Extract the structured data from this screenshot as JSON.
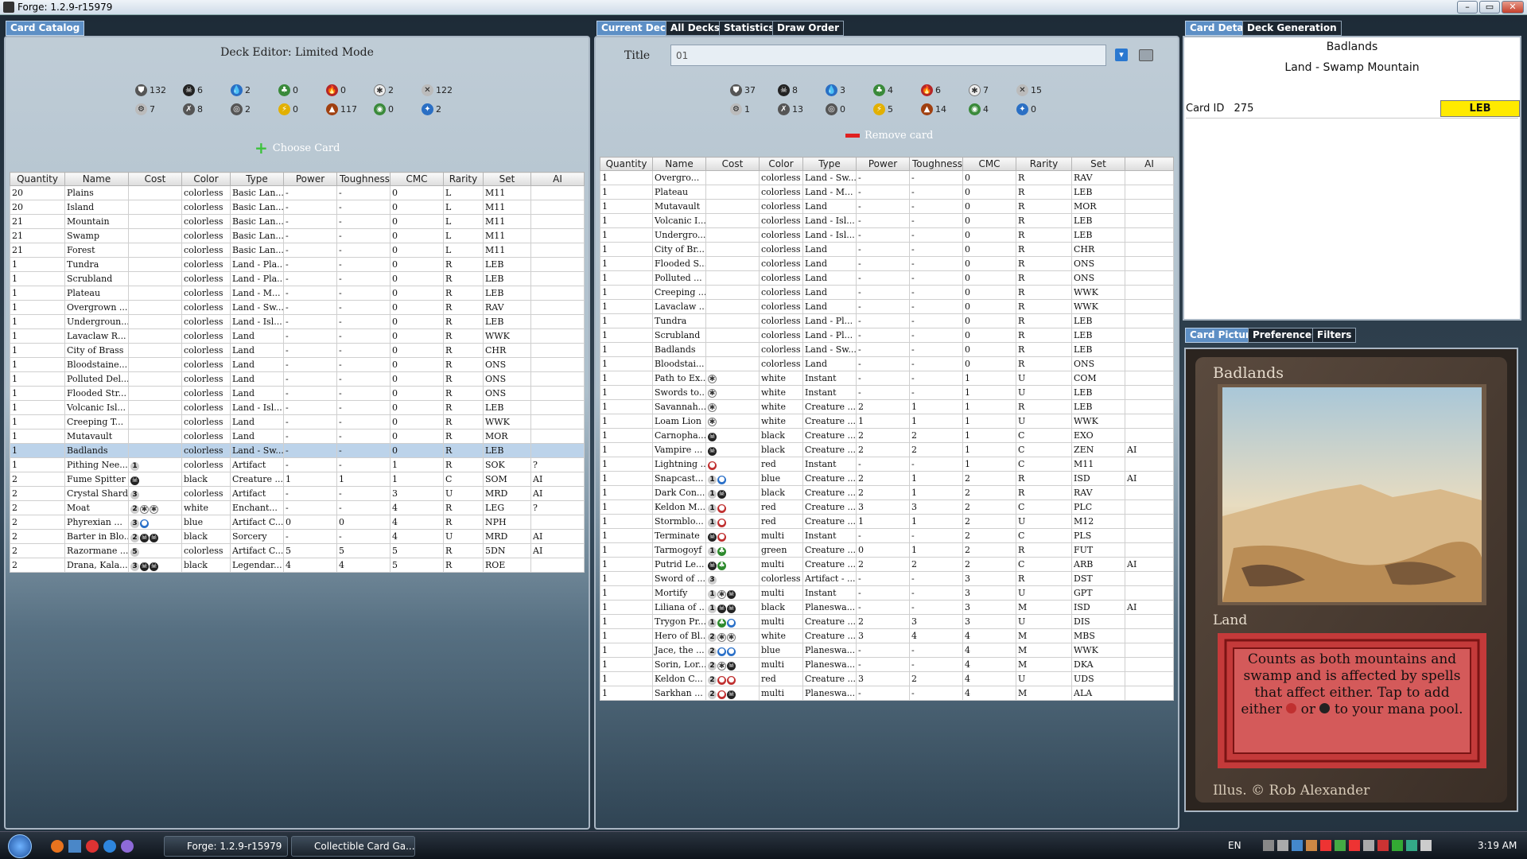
{
  "window": {
    "title": "Forge: 1.2.9-r15979",
    "btn_min": "–",
    "btn_max": "▭",
    "btn_close": "✕"
  },
  "left": {
    "tab": "Card Catalog",
    "heading": "Deck Editor: Limited Mode",
    "stats_row1": [
      {
        "icon": "total",
        "sym": "⛊",
        "cls": "x",
        "v": "132"
      },
      {
        "icon": "black",
        "sym": "☠",
        "cls": "",
        "v": "6"
      },
      {
        "icon": "blue",
        "sym": "💧",
        "cls": "u",
        "v": "2"
      },
      {
        "icon": "green",
        "sym": "♣",
        "cls": "g",
        "v": "0"
      },
      {
        "icon": "red",
        "sym": "🔥",
        "cls": "r",
        "v": "0"
      },
      {
        "icon": "white",
        "sym": "✱",
        "cls": "w",
        "v": "2"
      },
      {
        "icon": "colorless",
        "sym": "✕",
        "cls": "c",
        "v": "122"
      }
    ],
    "stats_row2": [
      {
        "icon": "artifact",
        "sym": "⚙",
        "cls": "c",
        "v": "7"
      },
      {
        "icon": "creature",
        "sym": "✗",
        "cls": "x",
        "v": "8"
      },
      {
        "icon": "enchantment",
        "sym": "◎",
        "cls": "x",
        "v": "2"
      },
      {
        "icon": "instant",
        "sym": "⚡",
        "cls": "y",
        "v": "0"
      },
      {
        "icon": "land",
        "sym": "▲",
        "cls": "o",
        "v": "117"
      },
      {
        "icon": "planeswalker",
        "sym": "◉",
        "cls": "g",
        "v": "0"
      },
      {
        "icon": "sorcery",
        "sym": "✦",
        "cls": "u",
        "v": "2"
      }
    ],
    "choose_label": "Choose Card",
    "columns": [
      "Quantity",
      "Name",
      "Cost",
      "Color",
      "Type",
      "Power",
      "Toughness",
      "CMC",
      "Rarity",
      "Set",
      "AI"
    ],
    "rows": [
      [
        "20",
        "Plains",
        "",
        "colorless",
        "Basic Lan...",
        "-",
        "-",
        "0",
        "L",
        "M11",
        ""
      ],
      [
        "20",
        "Island",
        "",
        "colorless",
        "Basic Lan...",
        "-",
        "-",
        "0",
        "L",
        "M11",
        ""
      ],
      [
        "21",
        "Mountain",
        "",
        "colorless",
        "Basic Lan...",
        "-",
        "-",
        "0",
        "L",
        "M11",
        ""
      ],
      [
        "21",
        "Swamp",
        "",
        "colorless",
        "Basic Lan...",
        "-",
        "-",
        "0",
        "L",
        "M11",
        ""
      ],
      [
        "21",
        "Forest",
        "",
        "colorless",
        "Basic Lan...",
        "-",
        "-",
        "0",
        "L",
        "M11",
        ""
      ],
      [
        "1",
        "Tundra",
        "",
        "colorless",
        "Land - Pla...",
        "-",
        "-",
        "0",
        "R",
        "LEB",
        ""
      ],
      [
        "1",
        "Scrubland",
        "",
        "colorless",
        "Land - Pla...",
        "-",
        "-",
        "0",
        "R",
        "LEB",
        ""
      ],
      [
        "1",
        "Plateau",
        "",
        "colorless",
        "Land - M...",
        "-",
        "-",
        "0",
        "R",
        "LEB",
        ""
      ],
      [
        "1",
        "Overgrown ...",
        "",
        "colorless",
        "Land - Sw...",
        "-",
        "-",
        "0",
        "R",
        "RAV",
        ""
      ],
      [
        "1",
        "Undergroun...",
        "",
        "colorless",
        "Land - Isl...",
        "-",
        "-",
        "0",
        "R",
        "LEB",
        ""
      ],
      [
        "1",
        "Lavaclaw R...",
        "",
        "colorless",
        "Land",
        "-",
        "-",
        "0",
        "R",
        "WWK",
        ""
      ],
      [
        "1",
        "City of Brass",
        "",
        "colorless",
        "Land",
        "-",
        "-",
        "0",
        "R",
        "CHR",
        ""
      ],
      [
        "1",
        "Bloodstaine...",
        "",
        "colorless",
        "Land",
        "-",
        "-",
        "0",
        "R",
        "ONS",
        ""
      ],
      [
        "1",
        "Polluted Del...",
        "",
        "colorless",
        "Land",
        "-",
        "-",
        "0",
        "R",
        "ONS",
        ""
      ],
      [
        "1",
        "Flooded Str...",
        "",
        "colorless",
        "Land",
        "-",
        "-",
        "0",
        "R",
        "ONS",
        ""
      ],
      [
        "1",
        "Volcanic Isl...",
        "",
        "colorless",
        "Land - Isl...",
        "-",
        "-",
        "0",
        "R",
        "LEB",
        ""
      ],
      [
        "1",
        "Creeping T...",
        "",
        "colorless",
        "Land",
        "-",
        "-",
        "0",
        "R",
        "WWK",
        ""
      ],
      [
        "1",
        "Mutavault",
        "",
        "colorless",
        "Land",
        "-",
        "-",
        "0",
        "R",
        "MOR",
        ""
      ],
      [
        "1",
        "Badlands",
        "",
        "colorless",
        "Land - Sw...",
        "-",
        "-",
        "0",
        "R",
        "LEB",
        ""
      ],
      [
        "1",
        "Pithing Nee...",
        "1",
        "colorless",
        "Artifact",
        "-",
        "-",
        "1",
        "R",
        "SOK",
        "?"
      ],
      [
        "2",
        "Fume Spitter",
        "B",
        "black",
        "Creature ...",
        "1",
        "1",
        "1",
        "C",
        "SOM",
        "AI"
      ],
      [
        "2",
        "Crystal Shard",
        "3",
        "colorless",
        "Artifact",
        "-",
        "-",
        "3",
        "U",
        "MRD",
        "AI"
      ],
      [
        "2",
        "Moat",
        "2WW",
        "white",
        "Enchant...",
        "-",
        "-",
        "4",
        "R",
        "LEG",
        "?"
      ],
      [
        "2",
        "Phyrexian ...",
        "3U",
        "blue",
        "Artifact C...",
        "0",
        "0",
        "4",
        "R",
        "NPH",
        ""
      ],
      [
        "2",
        "Barter in Blo...",
        "2BB",
        "black",
        "Sorcery",
        "-",
        "-",
        "4",
        "U",
        "MRD",
        "AI"
      ],
      [
        "2",
        "Razormane ...",
        "5",
        "colorless",
        "Artifact C...",
        "5",
        "5",
        "5",
        "R",
        "5DN",
        "AI"
      ],
      [
        "2",
        "Drana, Kala...",
        "3BB",
        "black",
        "Legendar...",
        "4",
        "4",
        "5",
        "R",
        "ROE",
        ""
      ]
    ],
    "selected_row": 18
  },
  "middle": {
    "tabs": [
      "Current Deck",
      "All Decks",
      "Statistics",
      "Draw Order"
    ],
    "title_label": "Title",
    "title_value": "01",
    "save_icon": "save-icon",
    "print_icon": "print-icon",
    "stats_row1": [
      {
        "icon": "total",
        "sym": "⛊",
        "cls": "x",
        "v": "37"
      },
      {
        "icon": "black",
        "sym": "☠",
        "cls": "",
        "v": "8"
      },
      {
        "icon": "blue",
        "sym": "💧",
        "cls": "u",
        "v": "3"
      },
      {
        "icon": "green",
        "sym": "♣",
        "cls": "g",
        "v": "4"
      },
      {
        "icon": "red",
        "sym": "🔥",
        "cls": "r",
        "v": "6"
      },
      {
        "icon": "white",
        "sym": "✱",
        "cls": "w",
        "v": "7"
      },
      {
        "icon": "colorless",
        "sym": "✕",
        "cls": "c",
        "v": "15"
      }
    ],
    "stats_row2": [
      {
        "icon": "artifact",
        "sym": "⚙",
        "cls": "c",
        "v": "1"
      },
      {
        "icon": "creature",
        "sym": "✗",
        "cls": "x",
        "v": "13"
      },
      {
        "icon": "enchantment",
        "sym": "◎",
        "cls": "x",
        "v": "0"
      },
      {
        "icon": "instant",
        "sym": "⚡",
        "cls": "y",
        "v": "5"
      },
      {
        "icon": "land",
        "sym": "▲",
        "cls": "o",
        "v": "14"
      },
      {
        "icon": "planeswalker",
        "sym": "◉",
        "cls": "g",
        "v": "4"
      },
      {
        "icon": "sorcery",
        "sym": "✦",
        "cls": "u",
        "v": "0"
      }
    ],
    "remove_label": "Remove card",
    "columns": [
      "Quantity",
      "Name",
      "Cost",
      "Color",
      "Type",
      "Power",
      "Toughness",
      "CMC",
      "Rarity",
      "Set",
      "AI"
    ],
    "rows": [
      [
        "1",
        "Overgro...",
        "",
        "colorless",
        "Land - Sw...",
        "-",
        "-",
        "0",
        "R",
        "RAV",
        ""
      ],
      [
        "1",
        "Plateau",
        "",
        "colorless",
        "Land - M...",
        "-",
        "-",
        "0",
        "R",
        "LEB",
        ""
      ],
      [
        "1",
        "Mutavault",
        "",
        "colorless",
        "Land",
        "-",
        "-",
        "0",
        "R",
        "MOR",
        ""
      ],
      [
        "1",
        "Volcanic I...",
        "",
        "colorless",
        "Land - Isl...",
        "-",
        "-",
        "0",
        "R",
        "LEB",
        ""
      ],
      [
        "1",
        "Undergro...",
        "",
        "colorless",
        "Land - Isl...",
        "-",
        "-",
        "0",
        "R",
        "LEB",
        ""
      ],
      [
        "1",
        "City of Br...",
        "",
        "colorless",
        "Land",
        "-",
        "-",
        "0",
        "R",
        "CHR",
        ""
      ],
      [
        "1",
        "Flooded S...",
        "",
        "colorless",
        "Land",
        "-",
        "-",
        "0",
        "R",
        "ONS",
        ""
      ],
      [
        "1",
        "Polluted ...",
        "",
        "colorless",
        "Land",
        "-",
        "-",
        "0",
        "R",
        "ONS",
        ""
      ],
      [
        "1",
        "Creeping ...",
        "",
        "colorless",
        "Land",
        "-",
        "-",
        "0",
        "R",
        "WWK",
        ""
      ],
      [
        "1",
        "Lavaclaw ...",
        "",
        "colorless",
        "Land",
        "-",
        "-",
        "0",
        "R",
        "WWK",
        ""
      ],
      [
        "1",
        "Tundra",
        "",
        "colorless",
        "Land - Pl...",
        "-",
        "-",
        "0",
        "R",
        "LEB",
        ""
      ],
      [
        "1",
        "Scrubland",
        "",
        "colorless",
        "Land - Pl...",
        "-",
        "-",
        "0",
        "R",
        "LEB",
        ""
      ],
      [
        "1",
        "Badlands",
        "",
        "colorless",
        "Land - Sw...",
        "-",
        "-",
        "0",
        "R",
        "LEB",
        ""
      ],
      [
        "1",
        "Bloodstai...",
        "",
        "colorless",
        "Land",
        "-",
        "-",
        "0",
        "R",
        "ONS",
        ""
      ],
      [
        "1",
        "Path to Ex...",
        "W",
        "white",
        "Instant",
        "-",
        "-",
        "1",
        "U",
        "COM",
        ""
      ],
      [
        "1",
        "Swords to...",
        "W",
        "white",
        "Instant",
        "-",
        "-",
        "1",
        "U",
        "LEB",
        ""
      ],
      [
        "1",
        "Savannah...",
        "W",
        "white",
        "Creature ...",
        "2",
        "1",
        "1",
        "R",
        "LEB",
        ""
      ],
      [
        "1",
        "Loam Lion",
        "W",
        "white",
        "Creature ...",
        "1",
        "1",
        "1",
        "U",
        "WWK",
        ""
      ],
      [
        "1",
        "Carnopha...",
        "B",
        "black",
        "Creature ...",
        "2",
        "2",
        "1",
        "C",
        "EXO",
        ""
      ],
      [
        "1",
        "Vampire ...",
        "B",
        "black",
        "Creature ...",
        "2",
        "2",
        "1",
        "C",
        "ZEN",
        "AI"
      ],
      [
        "1",
        "Lightning ...",
        "R",
        "red",
        "Instant",
        "-",
        "-",
        "1",
        "C",
        "M11",
        ""
      ],
      [
        "1",
        "Snapcast...",
        "1U",
        "blue",
        "Creature ...",
        "2",
        "1",
        "2",
        "R",
        "ISD",
        "AI"
      ],
      [
        "1",
        "Dark Con...",
        "1B",
        "black",
        "Creature ...",
        "2",
        "1",
        "2",
        "R",
        "RAV",
        ""
      ],
      [
        "1",
        "Keldon M...",
        "1R",
        "red",
        "Creature ...",
        "3",
        "3",
        "2",
        "C",
        "PLC",
        ""
      ],
      [
        "1",
        "Stormblo...",
        "1R",
        "red",
        "Creature ...",
        "1",
        "1",
        "2",
        "U",
        "M12",
        ""
      ],
      [
        "1",
        "Terminate",
        "BR",
        "multi",
        "Instant",
        "-",
        "-",
        "2",
        "C",
        "PLS",
        ""
      ],
      [
        "1",
        "Tarmogoyf",
        "1G",
        "green",
        "Creature ...",
        "0",
        "1",
        "2",
        "R",
        "FUT",
        ""
      ],
      [
        "1",
        "Putrid Le...",
        "BG",
        "multi",
        "Creature ...",
        "2",
        "2",
        "2",
        "C",
        "ARB",
        "AI"
      ],
      [
        "1",
        "Sword of ...",
        "3",
        "colorless",
        "Artifact - ...",
        "-",
        "-",
        "3",
        "R",
        "DST",
        ""
      ],
      [
        "1",
        "Mortify",
        "1WB",
        "multi",
        "Instant",
        "-",
        "-",
        "3",
        "U",
        "GPT",
        ""
      ],
      [
        "1",
        "Liliana of ...",
        "1BB",
        "black",
        "Planeswa...",
        "-",
        "-",
        "3",
        "M",
        "ISD",
        "AI"
      ],
      [
        "1",
        "Trygon Pr...",
        "1GU",
        "multi",
        "Creature ...",
        "2",
        "3",
        "3",
        "U",
        "DIS",
        ""
      ],
      [
        "1",
        "Hero of Bl...",
        "2WW",
        "white",
        "Creature ...",
        "3",
        "4",
        "4",
        "M",
        "MBS",
        ""
      ],
      [
        "1",
        "Jace, the ...",
        "2UU",
        "blue",
        "Planeswa...",
        "-",
        "-",
        "4",
        "M",
        "WWK",
        ""
      ],
      [
        "1",
        "Sorin, Lor...",
        "2WB",
        "multi",
        "Planeswa...",
        "-",
        "-",
        "4",
        "M",
        "DKA",
        ""
      ],
      [
        "1",
        "Keldon C...",
        "2RR",
        "red",
        "Creature ...",
        "3",
        "2",
        "4",
        "U",
        "UDS",
        ""
      ],
      [
        "1",
        "Sarkhan ...",
        "2RB",
        "multi",
        "Planeswa...",
        "-",
        "-",
        "4",
        "M",
        "ALA",
        ""
      ]
    ]
  },
  "right": {
    "tabs_top": [
      "Card Detail",
      "Deck Generation"
    ],
    "card_name": "Badlands",
    "card_type": "Land - Swamp Mountain",
    "card_id_label": "Card ID",
    "card_id": "275",
    "card_set": "LEB",
    "tabs_bottom": [
      "Card Picture",
      "Preferences",
      "Filters"
    ],
    "picture": {
      "name": "Badlands",
      "type_line": "Land",
      "rules": "Counts as both mountains and swamp and is affected by spells that affect either. Tap to add either",
      "rules_tail": "to your mana pool.",
      "artist": "Illus. © Rob Alexander"
    }
  },
  "taskbar": {
    "tasks": [
      "Forge: 1.2.9-r15979",
      "Collectible Card Ga..."
    ],
    "lang": "EN",
    "clock": "3:19 AM"
  }
}
